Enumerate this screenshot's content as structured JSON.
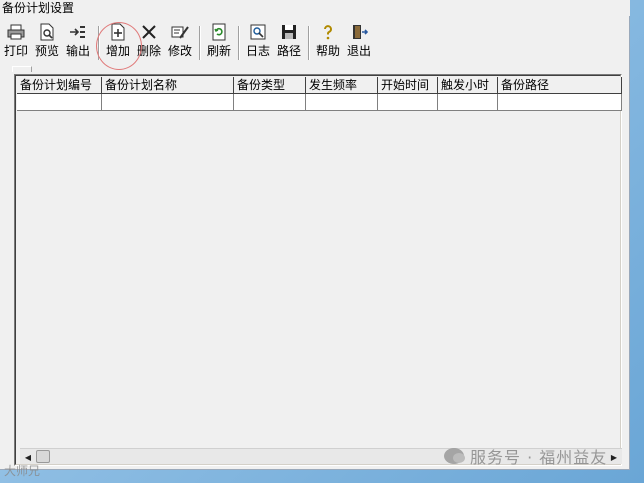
{
  "window": {
    "title": "备份计划设置"
  },
  "toolbar": {
    "buttons": [
      {
        "id": "print",
        "label": "打印",
        "icon": "printer-icon"
      },
      {
        "id": "preview",
        "label": "预览",
        "icon": "preview-icon"
      },
      {
        "id": "export",
        "label": "输出",
        "icon": "export-icon"
      },
      {
        "id": "add",
        "label": "增加",
        "icon": "add-document-icon"
      },
      {
        "id": "delete",
        "label": "删除",
        "icon": "delete-icon"
      },
      {
        "id": "edit",
        "label": "修改",
        "icon": "edit-icon"
      },
      {
        "id": "refresh",
        "label": "刷新",
        "icon": "refresh-icon"
      },
      {
        "id": "log",
        "label": "日志",
        "icon": "log-icon"
      },
      {
        "id": "path",
        "label": "路径",
        "icon": "save-disk-icon"
      },
      {
        "id": "help",
        "label": "帮助",
        "icon": "help-icon"
      },
      {
        "id": "exit",
        "label": "退出",
        "icon": "exit-door-icon"
      }
    ]
  },
  "grid": {
    "columns": [
      "备份计划编号",
      "备份计划名称",
      "备份类型",
      "发生频率",
      "开始时间",
      "触发小时",
      "备份路径"
    ],
    "rows": [
      [
        "",
        "",
        "",
        "",
        "",
        "",
        ""
      ]
    ]
  },
  "watermark": {
    "text": "服务号 · 福州益友",
    "left_text": "大师兄"
  },
  "colors": {
    "accent_circle": "#e07a7a",
    "window_bg": "#f0f0f0"
  }
}
